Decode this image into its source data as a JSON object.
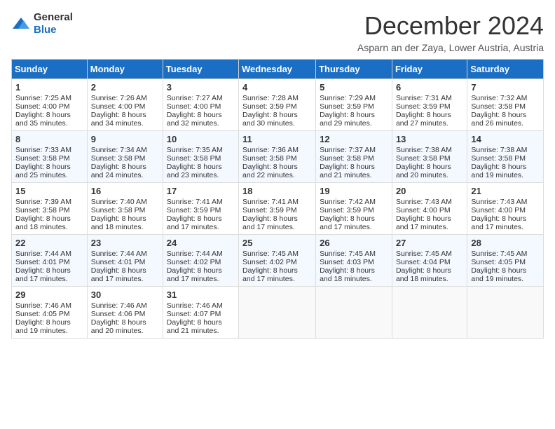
{
  "header": {
    "logo": {
      "general": "General",
      "blue": "Blue"
    },
    "title": "December 2024",
    "location": "Asparn an der Zaya, Lower Austria, Austria"
  },
  "calendar": {
    "days_of_week": [
      "Sunday",
      "Monday",
      "Tuesday",
      "Wednesday",
      "Thursday",
      "Friday",
      "Saturday"
    ],
    "weeks": [
      [
        null,
        {
          "day": 2,
          "sunrise": "Sunrise: 7:26 AM",
          "sunset": "Sunset: 4:00 PM",
          "daylight": "Daylight: 8 hours and 34 minutes."
        },
        {
          "day": 3,
          "sunrise": "Sunrise: 7:27 AM",
          "sunset": "Sunset: 4:00 PM",
          "daylight": "Daylight: 8 hours and 32 minutes."
        },
        {
          "day": 4,
          "sunrise": "Sunrise: 7:28 AM",
          "sunset": "Sunset: 3:59 PM",
          "daylight": "Daylight: 8 hours and 30 minutes."
        },
        {
          "day": 5,
          "sunrise": "Sunrise: 7:29 AM",
          "sunset": "Sunset: 3:59 PM",
          "daylight": "Daylight: 8 hours and 29 minutes."
        },
        {
          "day": 6,
          "sunrise": "Sunrise: 7:31 AM",
          "sunset": "Sunset: 3:59 PM",
          "daylight": "Daylight: 8 hours and 27 minutes."
        },
        {
          "day": 7,
          "sunrise": "Sunrise: 7:32 AM",
          "sunset": "Sunset: 3:58 PM",
          "daylight": "Daylight: 8 hours and 26 minutes."
        }
      ],
      [
        {
          "day": 1,
          "sunrise": "Sunrise: 7:25 AM",
          "sunset": "Sunset: 4:00 PM",
          "daylight": "Daylight: 8 hours and 35 minutes."
        },
        {
          "day": 8,
          "sunrise": "Sunrise: 7:33 AM",
          "sunset": "Sunset: 3:58 PM",
          "daylight": "Daylight: 8 hours and 25 minutes."
        },
        {
          "day": 9,
          "sunrise": "Sunrise: 7:34 AM",
          "sunset": "Sunset: 3:58 PM",
          "daylight": "Daylight: 8 hours and 24 minutes."
        },
        {
          "day": 10,
          "sunrise": "Sunrise: 7:35 AM",
          "sunset": "Sunset: 3:58 PM",
          "daylight": "Daylight: 8 hours and 23 minutes."
        },
        {
          "day": 11,
          "sunrise": "Sunrise: 7:36 AM",
          "sunset": "Sunset: 3:58 PM",
          "daylight": "Daylight: 8 hours and 22 minutes."
        },
        {
          "day": 12,
          "sunrise": "Sunrise: 7:37 AM",
          "sunset": "Sunset: 3:58 PM",
          "daylight": "Daylight: 8 hours and 21 minutes."
        },
        {
          "day": 13,
          "sunrise": "Sunrise: 7:38 AM",
          "sunset": "Sunset: 3:58 PM",
          "daylight": "Daylight: 8 hours and 20 minutes."
        },
        {
          "day": 14,
          "sunrise": "Sunrise: 7:38 AM",
          "sunset": "Sunset: 3:58 PM",
          "daylight": "Daylight: 8 hours and 19 minutes."
        }
      ],
      [
        {
          "day": 15,
          "sunrise": "Sunrise: 7:39 AM",
          "sunset": "Sunset: 3:58 PM",
          "daylight": "Daylight: 8 hours and 18 minutes."
        },
        {
          "day": 16,
          "sunrise": "Sunrise: 7:40 AM",
          "sunset": "Sunset: 3:58 PM",
          "daylight": "Daylight: 8 hours and 18 minutes."
        },
        {
          "day": 17,
          "sunrise": "Sunrise: 7:41 AM",
          "sunset": "Sunset: 3:59 PM",
          "daylight": "Daylight: 8 hours and 17 minutes."
        },
        {
          "day": 18,
          "sunrise": "Sunrise: 7:41 AM",
          "sunset": "Sunset: 3:59 PM",
          "daylight": "Daylight: 8 hours and 17 minutes."
        },
        {
          "day": 19,
          "sunrise": "Sunrise: 7:42 AM",
          "sunset": "Sunset: 3:59 PM",
          "daylight": "Daylight: 8 hours and 17 minutes."
        },
        {
          "day": 20,
          "sunrise": "Sunrise: 7:43 AM",
          "sunset": "Sunset: 4:00 PM",
          "daylight": "Daylight: 8 hours and 17 minutes."
        },
        {
          "day": 21,
          "sunrise": "Sunrise: 7:43 AM",
          "sunset": "Sunset: 4:00 PM",
          "daylight": "Daylight: 8 hours and 17 minutes."
        }
      ],
      [
        {
          "day": 22,
          "sunrise": "Sunrise: 7:44 AM",
          "sunset": "Sunset: 4:01 PM",
          "daylight": "Daylight: 8 hours and 17 minutes."
        },
        {
          "day": 23,
          "sunrise": "Sunrise: 7:44 AM",
          "sunset": "Sunset: 4:01 PM",
          "daylight": "Daylight: 8 hours and 17 minutes."
        },
        {
          "day": 24,
          "sunrise": "Sunrise: 7:44 AM",
          "sunset": "Sunset: 4:02 PM",
          "daylight": "Daylight: 8 hours and 17 minutes."
        },
        {
          "day": 25,
          "sunrise": "Sunrise: 7:45 AM",
          "sunset": "Sunset: 4:02 PM",
          "daylight": "Daylight: 8 hours and 17 minutes."
        },
        {
          "day": 26,
          "sunrise": "Sunrise: 7:45 AM",
          "sunset": "Sunset: 4:03 PM",
          "daylight": "Daylight: 8 hours and 18 minutes."
        },
        {
          "day": 27,
          "sunrise": "Sunrise: 7:45 AM",
          "sunset": "Sunset: 4:04 PM",
          "daylight": "Daylight: 8 hours and 18 minutes."
        },
        {
          "day": 28,
          "sunrise": "Sunrise: 7:45 AM",
          "sunset": "Sunset: 4:05 PM",
          "daylight": "Daylight: 8 hours and 19 minutes."
        }
      ],
      [
        {
          "day": 29,
          "sunrise": "Sunrise: 7:46 AM",
          "sunset": "Sunset: 4:05 PM",
          "daylight": "Daylight: 8 hours and 19 minutes."
        },
        {
          "day": 30,
          "sunrise": "Sunrise: 7:46 AM",
          "sunset": "Sunset: 4:06 PM",
          "daylight": "Daylight: 8 hours and 20 minutes."
        },
        {
          "day": 31,
          "sunrise": "Sunrise: 7:46 AM",
          "sunset": "Sunset: 4:07 PM",
          "daylight": "Daylight: 8 hours and 21 minutes."
        },
        null,
        null,
        null,
        null
      ]
    ]
  }
}
